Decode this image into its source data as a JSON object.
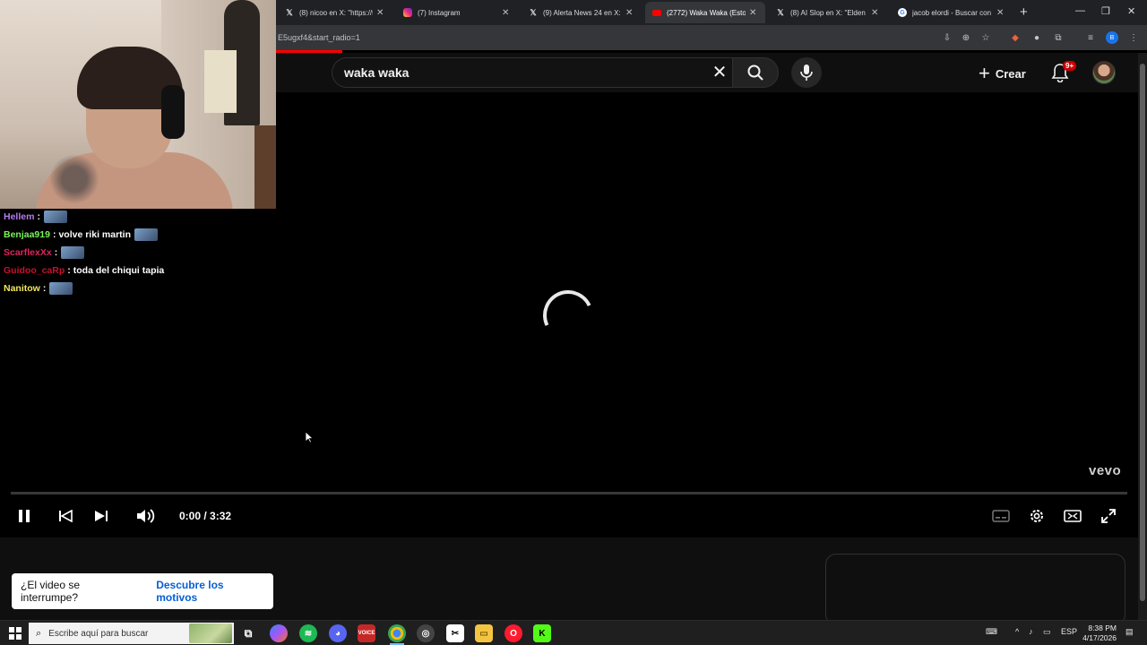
{
  "browser": {
    "tabs": [
      {
        "title": "(8) nicoo en X: \"https://t.c",
        "favicon": "x-logo",
        "active": false
      },
      {
        "title": "(7) Instagram",
        "favicon": "instagram-logo",
        "active": false
      },
      {
        "title": "(9) Alerta News 24 en X: \"",
        "favicon": "x-logo",
        "active": false
      },
      {
        "title": "(2772) Waka Waka (Esto es",
        "favicon": "youtube-logo",
        "active": true
      },
      {
        "title": "(8) AI Slop en X: \"Elden R",
        "favicon": "x-logo",
        "active": false
      },
      {
        "title": "jacob elordi - Buscar con",
        "favicon": "google-logo",
        "active": false
      }
    ],
    "url": "E5ugxf4&start_radio=1"
  },
  "youtube": {
    "search_query": "waka waka",
    "create_label": "Crear",
    "notification_badge": "9+",
    "player": {
      "watermark": "vevo",
      "current_time": "0:00",
      "duration": "3:32",
      "time_display": "0:00 / 3:32",
      "progress": 0.0,
      "state": "loading"
    },
    "interrupt_banner": {
      "question": "¿El video se interrumpe?",
      "link": "Descubre los motivos"
    }
  },
  "chat": [
    {
      "user": "Hellem",
      "color": "#b57cf0",
      "message": "",
      "emote": true,
      "sep": ":"
    },
    {
      "user": "Benjaa919",
      "color": "#7cf25a",
      "message": "volve riki martin",
      "emote": true,
      "sep": ":"
    },
    {
      "user": "ScarflexXx",
      "color": "#e0245e",
      "message": "",
      "emote": true,
      "sep": ":"
    },
    {
      "user": "Guidoo_caRp",
      "color": "#c8102e",
      "message": "toda del chiqui tapia",
      "emote": false,
      "sep": ":"
    },
    {
      "user": "Nanitow",
      "color": "#f2e85a",
      "message": "",
      "emote": true,
      "sep": ":"
    }
  ],
  "taskbar": {
    "search_placeholder": "Escribe aquí para buscar",
    "language": "ESP",
    "time": "8:38 PM",
    "date": "4/17/2026"
  },
  "colors": {
    "youtube_red": "#ff0000",
    "link_blue": "#065fd4"
  }
}
